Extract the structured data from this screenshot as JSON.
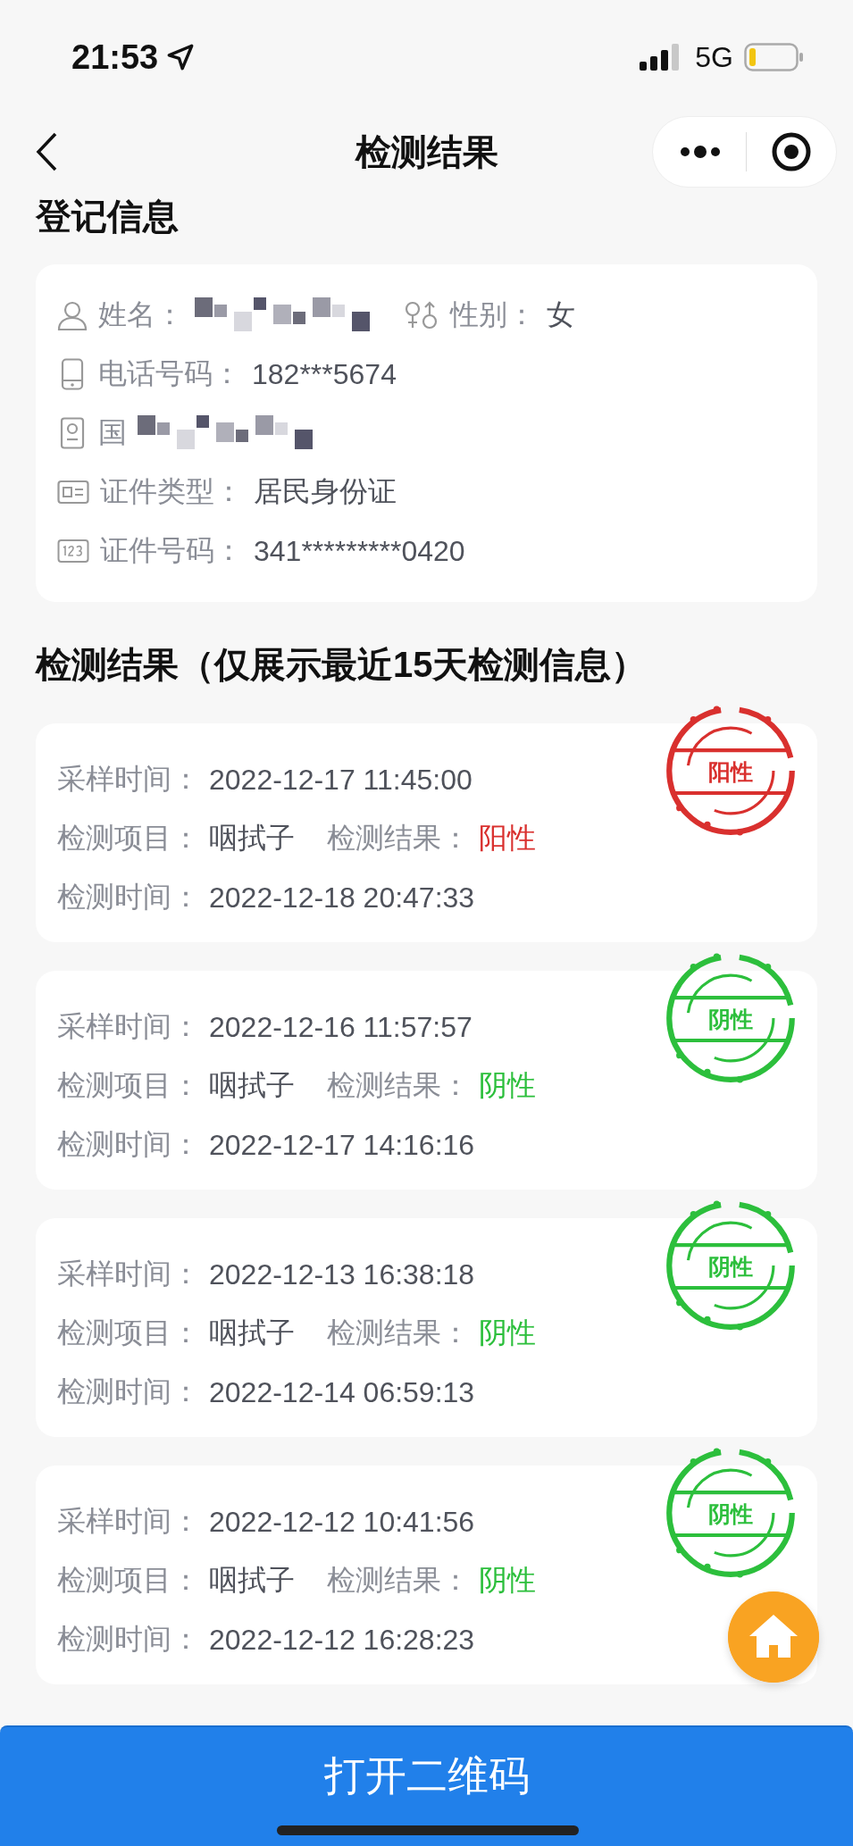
{
  "status_bar": {
    "time": "21:53",
    "network": "5G"
  },
  "nav": {
    "title": "检测结果"
  },
  "registration": {
    "title": "登记信息",
    "rows": [
      {
        "fields": [
          {
            "kind": "name",
            "label": "姓名：",
            "redacted": true
          },
          {
            "kind": "gender",
            "label": "性别：",
            "value": "女"
          }
        ]
      },
      {
        "fields": [
          {
            "kind": "phone",
            "label": "电话号码：",
            "value": "182***5674"
          }
        ]
      },
      {
        "fields": [
          {
            "kind": "nationality",
            "label": "国",
            "redacted": true
          }
        ]
      },
      {
        "fields": [
          {
            "kind": "idtype",
            "label": "证件类型：",
            "value": "居民身份证"
          }
        ]
      },
      {
        "fields": [
          {
            "kind": "idnumber",
            "label": "证件号码：",
            "value": "341*********0420"
          }
        ]
      }
    ]
  },
  "results": {
    "title": "检测结果（仅展示最近15天检测信息）",
    "items": [
      {
        "sample_label": "采样时间：",
        "sample_time": "2022-12-17 11:45:00",
        "item_label": "检测项目：",
        "item": "咽拭子",
        "result_label": "检测结果：",
        "result": "阳性",
        "kind": "positive",
        "stamp": "阳性",
        "test_label": "检测时间：",
        "test_time": "2022-12-18 20:47:33"
      },
      {
        "sample_label": "采样时间：",
        "sample_time": "2022-12-16 11:57:57",
        "item_label": "检测项目：",
        "item": "咽拭子",
        "result_label": "检测结果：",
        "result": "阴性",
        "kind": "negative",
        "stamp": "阴性",
        "test_label": "检测时间：",
        "test_time": "2022-12-17 14:16:16"
      },
      {
        "sample_label": "采样时间：",
        "sample_time": "2022-12-13 16:38:18",
        "item_label": "检测项目：",
        "item": "咽拭子",
        "result_label": "检测结果：",
        "result": "阴性",
        "kind": "negative",
        "stamp": "阴性",
        "test_label": "检测时间：",
        "test_time": "2022-12-14 06:59:13"
      },
      {
        "sample_label": "采样时间：",
        "sample_time": "2022-12-12 10:41:56",
        "item_label": "检测项目：",
        "item": "咽拭子",
        "result_label": "检测结果：",
        "result": "阴性",
        "kind": "negative",
        "stamp": "阴性",
        "test_label": "检测时间：",
        "test_time": "2022-12-12 16:28:23"
      }
    ]
  },
  "bottom_button": {
    "label": "打开二维码"
  }
}
